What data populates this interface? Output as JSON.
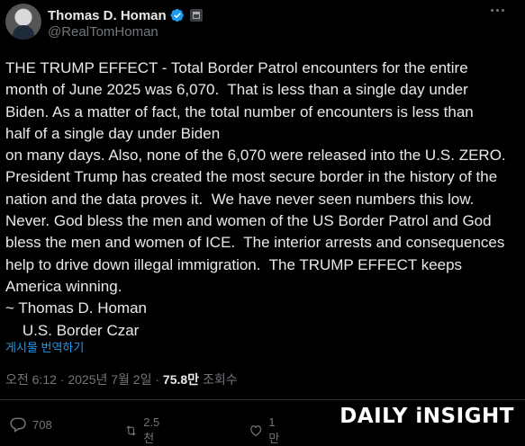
{
  "author": {
    "name": "Thomas D. Homan",
    "handle": "@RealTomHoman",
    "verified_color": "#1d9bf0"
  },
  "post": {
    "text": "THE TRUMP EFFECT - Total Border Patrol encounters for the entire\nmonth of June 2025 was 6,070.  That is less than a single day under\nBiden. As a matter of fact, the total number of encounters is less than\nhalf of a single day under Biden\non many days. Also, none of the 6,070 were released into the U.S. ZERO.\nPresident Trump has created the most secure border in the history of the\nnation and the data proves it.  We have never seen numbers this low.\nNever. God bless the men and women of the US Border Patrol and God\nbless the men and women of ICE.  The interior arrests and consequences\nhelp to drive down illegal immigration.  The TRUMP EFFECT keeps\nAmerica winning.\n~ Thomas D. Homan\n    U.S. Border Czar",
    "translate_label": "게시물 번역하기",
    "time": "오전 6:12 · 2025년 7월 2일 · ",
    "views": "75.8만",
    "views_label": " 조회수"
  },
  "actions": {
    "replies": "708",
    "reposts": "2.5천",
    "likes": "1만"
  },
  "watermark": "DAILY iNSIGHT",
  "icons": [
    "more-icon",
    "verified-icon",
    "government-icon",
    "reply-icon",
    "repost-icon",
    "like-icon"
  ]
}
